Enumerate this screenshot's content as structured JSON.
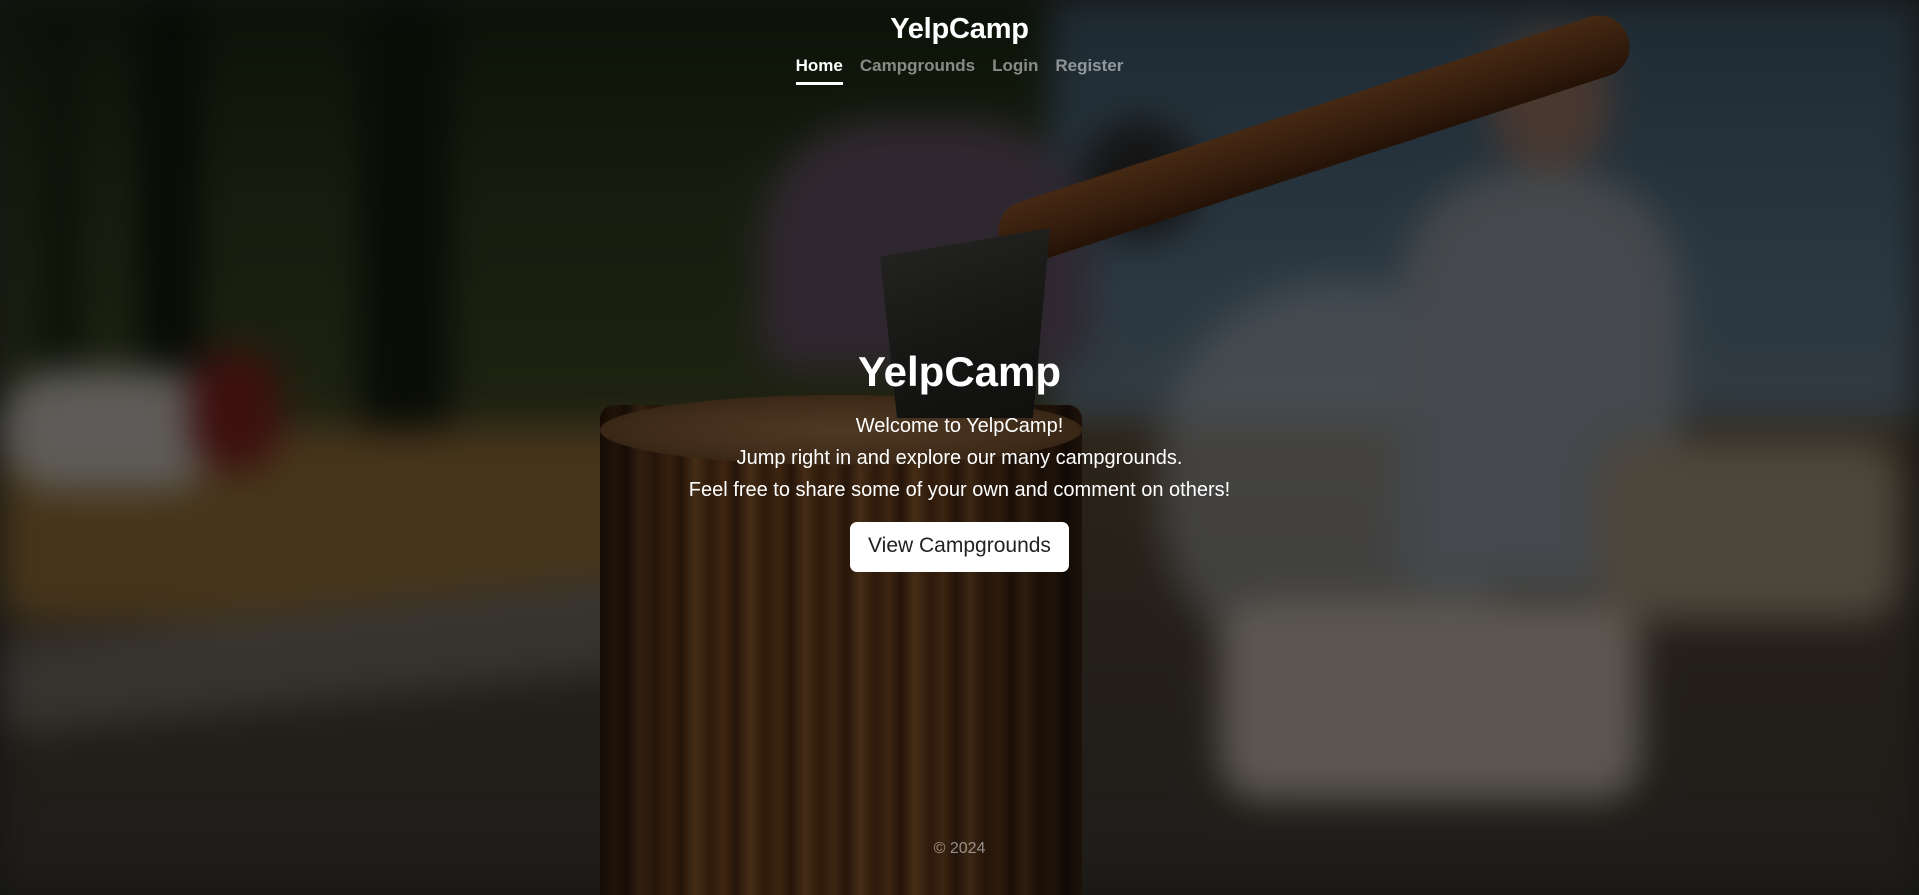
{
  "header": {
    "brand": "YelpCamp",
    "nav": {
      "home": "Home",
      "campgrounds": "Campgrounds",
      "login": "Login",
      "register": "Register"
    },
    "active_tab": "Home"
  },
  "hero": {
    "title": "YelpCamp",
    "line1": "Welcome to YelpCamp!",
    "line2": "Jump right in and explore our many campgrounds.",
    "line3": "Feel free to share some of your own and comment on others!",
    "button_label": "View Campgrounds"
  },
  "footer": {
    "copyright": "© 2024"
  },
  "colors": {
    "text": "#ffffff",
    "muted_text": "rgba(255,255,255,0.5)",
    "button_bg": "#ffffff",
    "button_text": "#222222",
    "overlay": "rgba(0,0,0,0.5)"
  }
}
